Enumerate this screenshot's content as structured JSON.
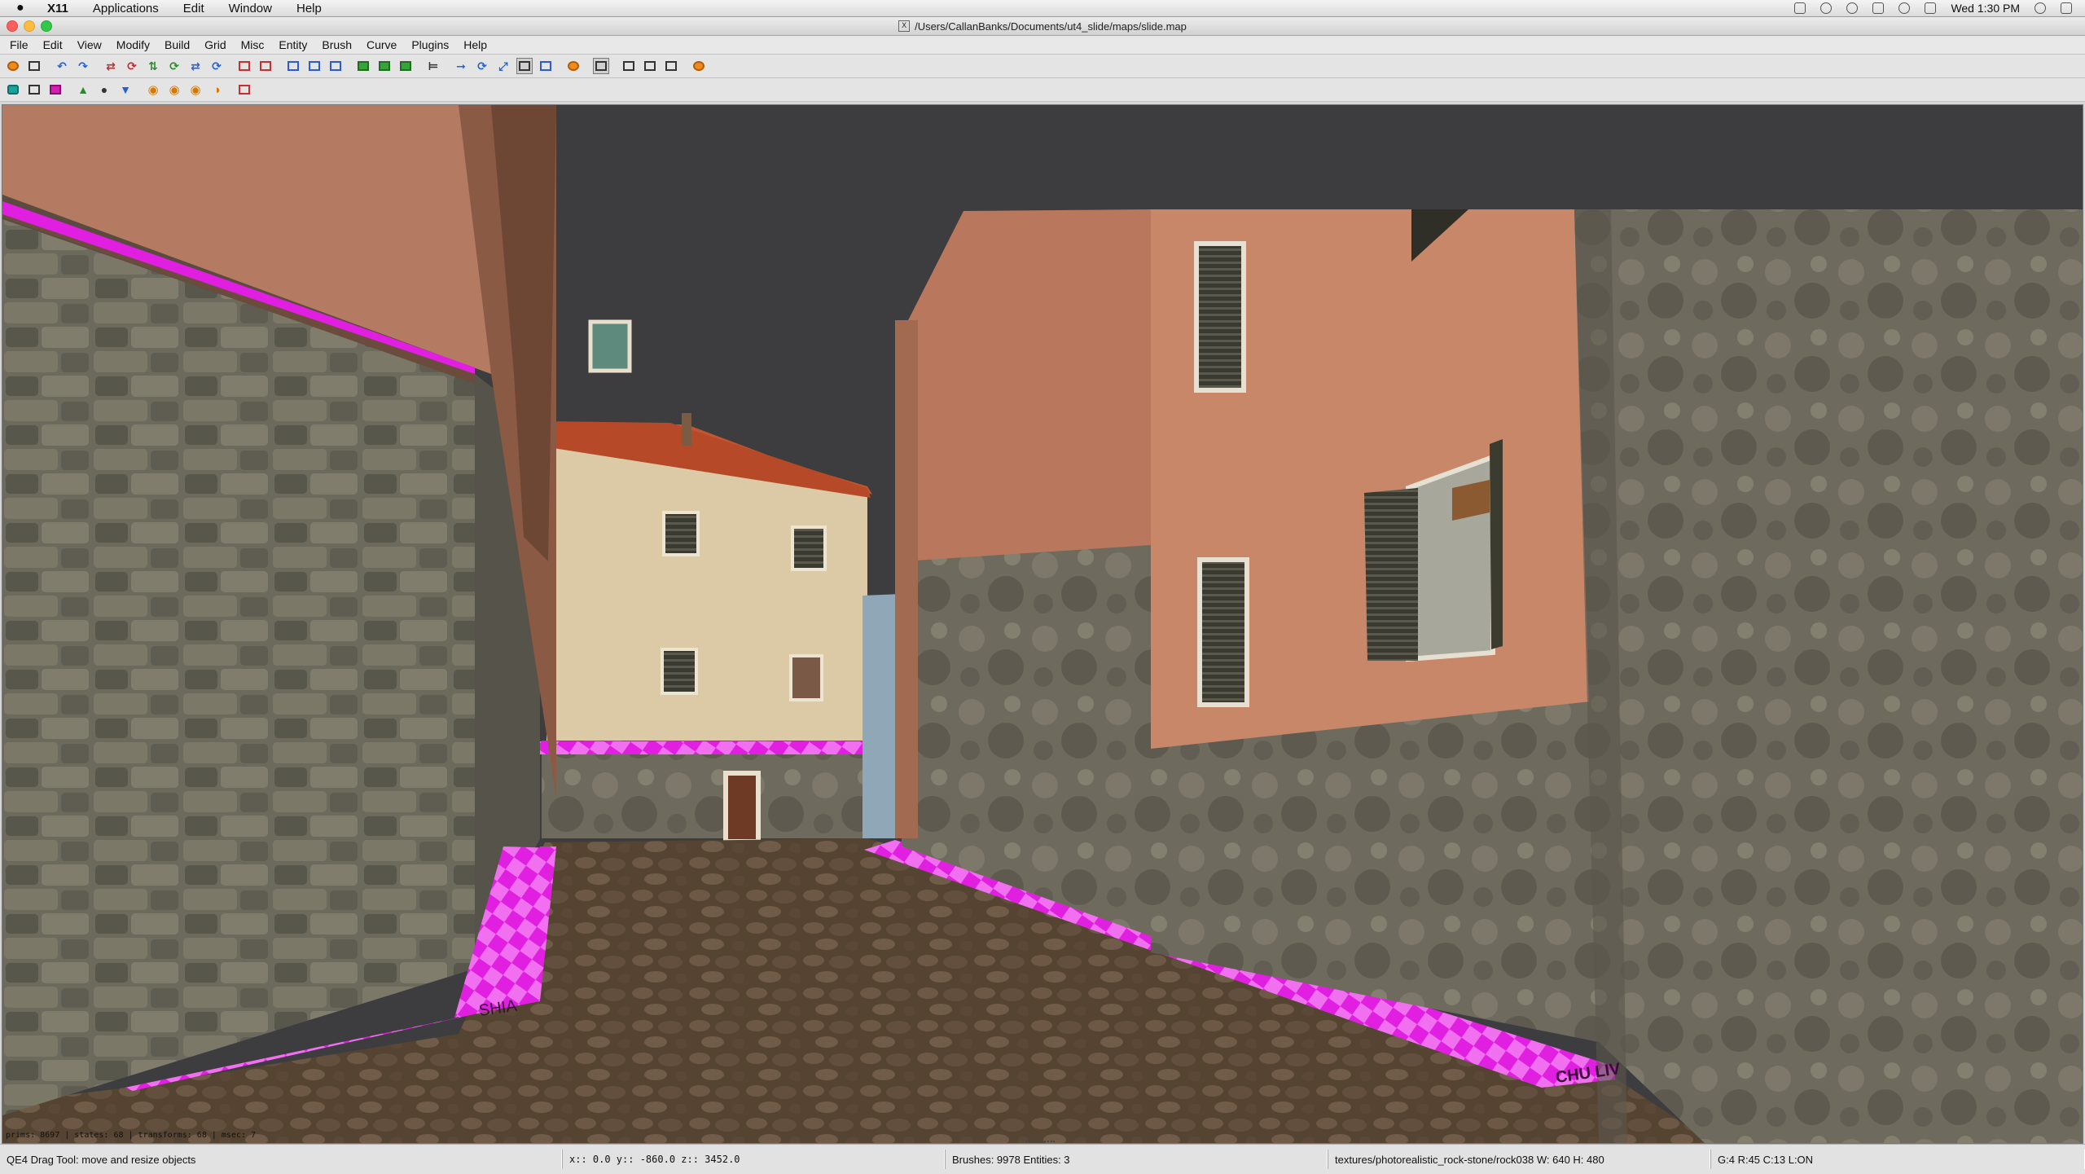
{
  "macos_menubar": {
    "app": "X11",
    "items": [
      "Applications",
      "Edit",
      "Window",
      "Help"
    ],
    "clock": "Wed 1:30 PM"
  },
  "window": {
    "title": "/Users/CallanBanks/Documents/ut4_slide/maps/slide.map"
  },
  "app_menu": {
    "items": [
      "File",
      "Edit",
      "View",
      "Modify",
      "Build",
      "Grid",
      "Misc",
      "Entity",
      "Brush",
      "Curve",
      "Plugins",
      "Help"
    ]
  },
  "viewport": {
    "stats": "prims: 8697 | states: 68 | transforms: 68 | msec: 7",
    "floor_label_left": "SHIA",
    "floor_label_right": "CHU LIV",
    "colors": {
      "sky": "#3d3d3f",
      "caulk_magenta": "#e31fe0",
      "cobble": "#5e4a37",
      "stone_wall": "#6e6a5c",
      "plaster_orange": "#c5896a",
      "plaster_cream": "#dcccaa"
    }
  },
  "statusbar": {
    "tool": "QE4 Drag Tool: move and resize objects",
    "coords": "x::    0.0  y:: -860.0  z:: 3452.0",
    "counts": "Brushes: 9978 Entities: 3",
    "texture": "textures/photorealistic_rock-stone/rock038 W: 640 H: 480",
    "grid": "G:4  R:45  C:13  L:ON"
  }
}
